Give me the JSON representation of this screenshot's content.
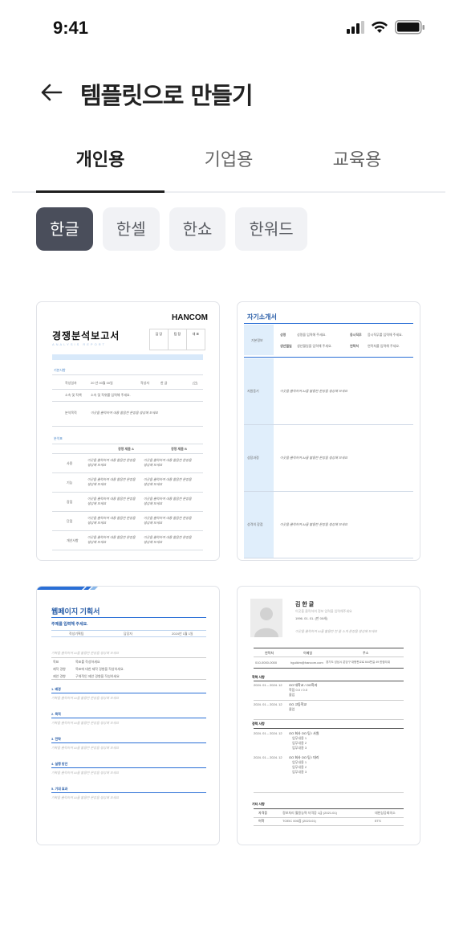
{
  "status": {
    "time": "9:41"
  },
  "header": {
    "title": "템플릿으로 만들기"
  },
  "tabs": [
    {
      "label": "개인용",
      "active": true
    },
    {
      "label": "기업용",
      "active": false
    },
    {
      "label": "교육용",
      "active": false
    }
  ],
  "chips": [
    {
      "label": "한글",
      "active": true
    },
    {
      "label": "한셀",
      "active": false
    },
    {
      "label": "한쇼",
      "active": false
    },
    {
      "label": "한워드",
      "active": false
    }
  ],
  "colors": {
    "chip_active": "#4a4e5b",
    "accent_blue": "#2a6fd6",
    "tab_indicator": "#1e1e1e"
  },
  "templates": {
    "competitor": {
      "brand": "HANCOM",
      "title": "경쟁분석보고서",
      "subtitle": "ANALYSIS REPORT",
      "approvals": [
        "담 당",
        "팀 장",
        "대 표"
      ],
      "basic_info": "기본사항",
      "date_label": "작성일자",
      "date_value": "20 년 00월 00일",
      "author_label": "작성자",
      "author_value": "한 글",
      "seal": "(인)",
      "dept_label": "소속 및 직책",
      "dept_value": "소속 및 직위를 입력해 주세요.",
      "purpose_label": "분석목적",
      "placeholder": "이곳을 클릭하여 내용 몰음한 문장을 생성해 보세요",
      "section2": "분석표",
      "col_a": "경쟁 제품 A",
      "col_b": "경쟁 제품 B",
      "rows": [
        "사용",
        "기능",
        "장점",
        "단점",
        "개선사항"
      ]
    },
    "intro": {
      "title": "자기소개서",
      "basic": "기본정보",
      "name_label": "성명",
      "name_value": "성명을 입력해 주세요.",
      "job_label": "응시직무",
      "job_value": "응시직무를 입력해 주세요.",
      "birth_label": "생년월일",
      "birth_value": "생년월일을 입력해 주세요.",
      "contact_label": "연락처",
      "contact_value": "연락처를 입력해 주세요.",
      "sections": [
        "지원동기",
        "성장과정",
        "성격의 장점"
      ],
      "placeholder": "이곳을 클릭하여 AI를 활용한 문장을 생성해 보세요"
    },
    "webpage": {
      "title": "웹페이지 기획서",
      "topic": "주제를 입력해 주세요.",
      "author": "작성기획팀",
      "manager": "담당자",
      "date": "2024년 1월 1일",
      "placeholder": "기획을 클릭하여 AI를 활용한 문장을 생성해 보세요",
      "goal_label": "목표",
      "goal_value": "목표를 작성하세요",
      "reason_label": "제작 경향",
      "reason_value": "목표에 대한 제작 경향을 작성하세요.",
      "effect_label": "제안 경향",
      "effect_value": "구체적인 제안 경향을 작성하세요",
      "sections": [
        "1. 배경",
        "2. 목적",
        "3. 전략",
        "4. 실행 방안",
        "5. 기대 효과"
      ]
    },
    "resume": {
      "name": "김 한 글",
      "line1": "이곳을 클릭하여 정보 입력을 입력해주세요",
      "line2": "1996. 01. 01. (만 00세)",
      "line3": "이곳을 클릭하여 AI를 활용한 한 줄 소개 문장을 생성해 보세요",
      "headers": [
        "연락처",
        "이메일",
        "주소"
      ],
      "values": [
        "010-0000-0000",
        "hgulkim@hancom.com",
        "경기도 성남시 분당구 대왕판교로 644번길 49 한컴타워"
      ],
      "sec1": "학력 사항",
      "edu": [
        {
          "period": "2024. 01 – 2024. 12",
          "school": "OO 대학교 / OO학과",
          "detail": "학점 0.0 / 0.0",
          "status": "졸업"
        },
        {
          "period": "2024. 01 – 2024. 12",
          "school": "OO 고등학교",
          "detail": "졸업",
          "status": ""
        }
      ],
      "sec2": "경력 사항",
      "career": [
        {
          "period": "2024. 01 – 2024. 12",
          "company": "OO 회사 OO 팀 / 사원",
          "items": [
            "업무내용 1",
            "업무내용 2",
            "업무내용 3"
          ]
        },
        {
          "period": "2024. 01 – 2024. 12",
          "company": "OO 회사 OO 팀 / 대리",
          "items": [
            "업무내용 1",
            "업무내용 2",
            "업무내용 3"
          ]
        }
      ],
      "sec3": "기타 사항",
      "other": [
        {
          "k": "자격증",
          "v": "정보처리 활용능력 자격증 1급 (2021.01)",
          "x": "대한상공회의소"
        },
        {
          "k": "어학",
          "v": "TOEIC 000점 (2023.01)",
          "x": "ETS"
        }
      ]
    }
  }
}
